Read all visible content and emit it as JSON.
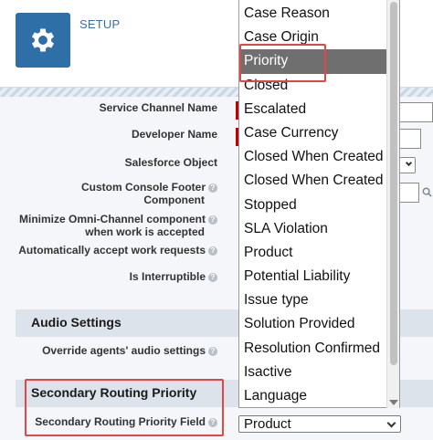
{
  "header": {
    "setup_label": "SETUP",
    "icon": "gear-icon",
    "icon_color": "#2e6fa7"
  },
  "form": {
    "fields": [
      {
        "label": "Service Channel Name",
        "required": true
      },
      {
        "label": "Developer Name",
        "required": true
      },
      {
        "label": "Salesforce Object"
      },
      {
        "label_line1": "Custom Console Footer",
        "label_line2": "Component",
        "help": true
      },
      {
        "label_line1": "Minimize Omni-Channel component",
        "label_line2": "when work is accepted",
        "help": true
      },
      {
        "label": "Automatically accept work requests",
        "help": true
      },
      {
        "label": "Is Interruptible",
        "help": true
      }
    ],
    "audio_section": {
      "title": "Audio Settings",
      "field_label": "Override agents' audio settings"
    },
    "secondary_section": {
      "title": "Secondary Routing Priority",
      "field_label": "Secondary Routing Priority Field",
      "selected_value": "Product"
    }
  },
  "dropdown": {
    "options": [
      "Case Reason",
      "Case Origin",
      "Priority",
      "Closed",
      "Escalated",
      "Case Currency",
      "Closed When Created",
      "Closed When Created",
      "Stopped",
      "SLA Violation",
      "Product",
      "Potential Liability",
      "Issue type",
      "Solution Provided",
      "Resolution Confirmed",
      "Isactive",
      "Language"
    ],
    "highlighted": "Priority"
  },
  "colors": {
    "highlight_border": "#e04848",
    "section_band": "#dde3ea",
    "selected_option_bg": "#6f6f6f"
  }
}
